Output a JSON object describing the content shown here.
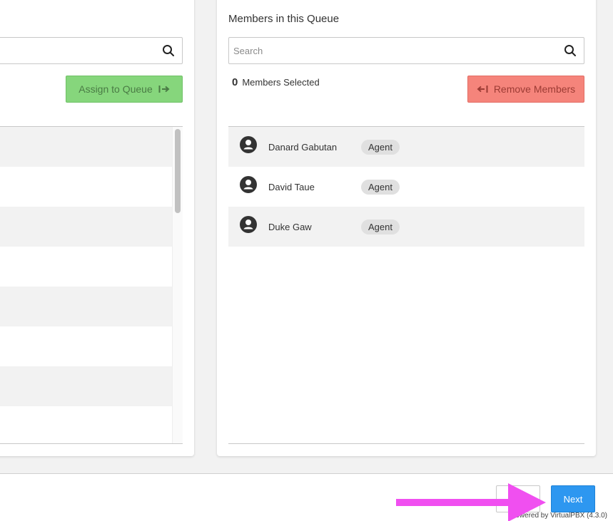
{
  "left_panel": {
    "search": {
      "placeholder": "",
      "value": ""
    },
    "assign_label": "Assign to Queue",
    "assign_icon": "arrow-right-to-bar-icon",
    "rows": 8
  },
  "right_panel": {
    "title": "Members in this Queue",
    "search": {
      "placeholder": "Search",
      "value": ""
    },
    "selected_count": "0",
    "selected_label": "Members Selected",
    "remove_label": "Remove Members",
    "remove_icon": "arrow-left-from-bar-icon",
    "members": [
      {
        "name": "Danard Gabutan",
        "role": "Agent"
      },
      {
        "name": "David Taue",
        "role": "Agent"
      },
      {
        "name": "Duke Gaw",
        "role": "Agent"
      }
    ]
  },
  "footer": {
    "next_label": "Next",
    "back_label": "",
    "powered_by": "owered by VirtualPBX  (4.3.0)"
  },
  "colors": {
    "assign": "#86d67c",
    "remove": "#f5847b",
    "next": "#2d97f0",
    "annotation_arrow": "#f04ff0"
  }
}
